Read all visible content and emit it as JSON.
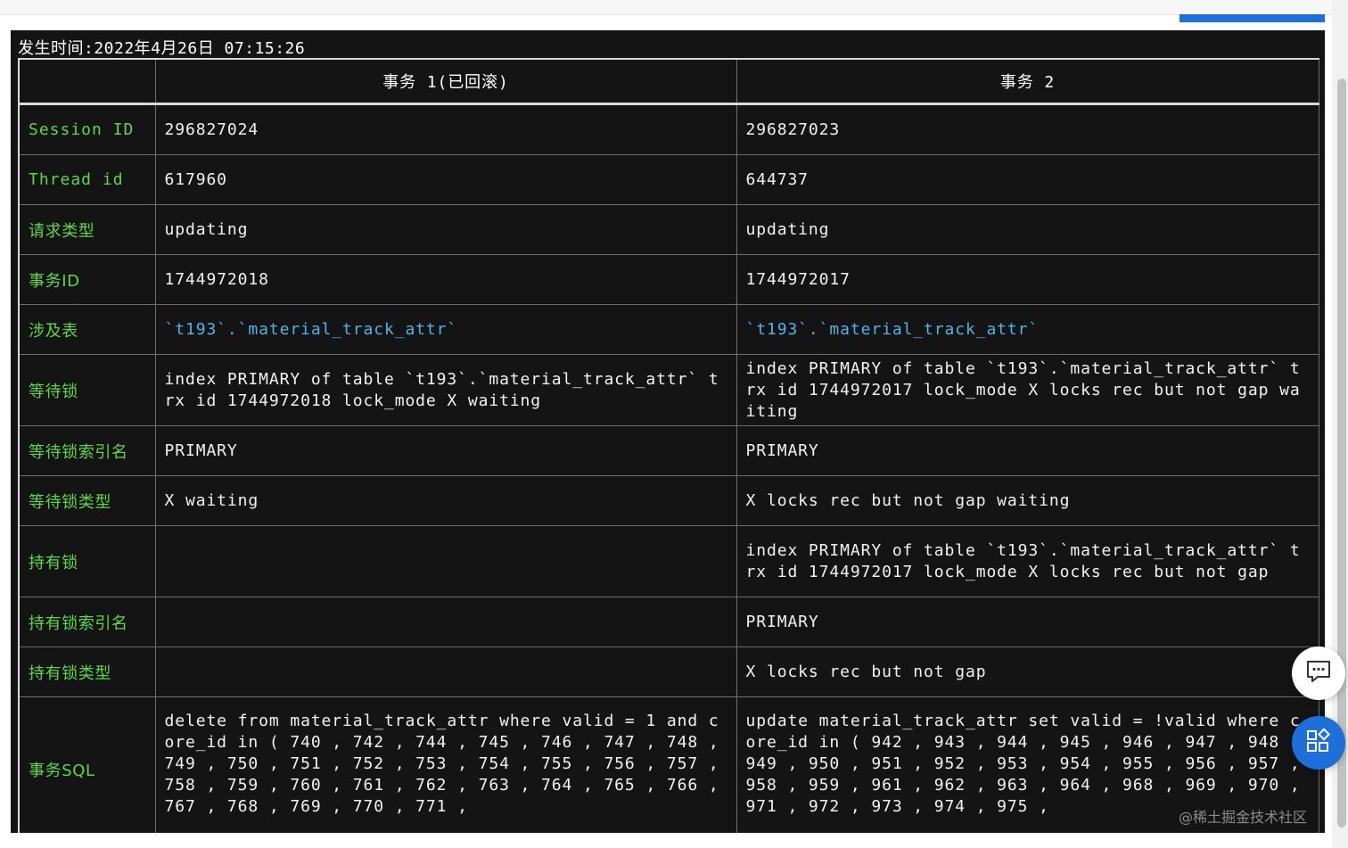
{
  "timestamp_label": "发生时间:2022年4月26日 07:15:26",
  "table": {
    "headers": [
      "",
      "事务 1(已回滚)",
      "事务 2"
    ],
    "rows": [
      {
        "label": "Session ID",
        "t1": "296827024",
        "t2": "296827023"
      },
      {
        "label": "Thread id",
        "t1": "617960",
        "t2": "644737"
      },
      {
        "label": "请求类型",
        "t1": "updating",
        "t2": "updating"
      },
      {
        "label": "事务ID",
        "t1": "1744972018",
        "t2": "1744972017"
      },
      {
        "label": "涉及表",
        "t1": "`t193`.`material_track_attr`",
        "t2": "`t193`.`material_track_attr`"
      },
      {
        "label": "等待锁",
        "t1": "index PRIMARY of table `t193`.`material_track_attr` trx id 1744972018 lock_mode X waiting",
        "t2": "index PRIMARY of table `t193`.`material_track_attr` trx id 1744972017 lock_mode X locks rec but not gap waiting"
      },
      {
        "label": "等待锁索引名",
        "t1": "PRIMARY",
        "t2": "PRIMARY"
      },
      {
        "label": "等待锁类型",
        "t1": "X waiting",
        "t2": "X locks rec but not gap waiting"
      },
      {
        "label": "持有锁",
        "t1": "",
        "t2": "index PRIMARY of table `t193`.`material_track_attr` trx id 1744972017 lock_mode X locks rec but not gap"
      },
      {
        "label": "持有锁索引名",
        "t1": "",
        "t2": "PRIMARY"
      },
      {
        "label": "持有锁类型",
        "t1": "",
        "t2": "X locks rec but not gap"
      },
      {
        "label": "事务SQL",
        "t1": "delete from material_track_attr where valid = 1 and core_id in ( 740 , 742 , 744 , 745 , 746 , 747 , 748 , 749 , 750 , 751 , 752 , 753 , 754 , 755 , 756 , 757 , 758 , 759 , 760 , 761 , 762 , 763 , 764 , 765 , 766 , 767 , 768 , 769 , 770 , 771 ,",
        "t2": "update material_track_attr set valid = !valid where core_id in ( 942 , 943 , 944 , 945 , 946 , 947 , 948 , 949 , 950 , 951 , 952 , 953 , 954 , 955 , 956 , 957 , 958 , 959 , 961 , 962 , 963 , 964 , 968 , 969 , 970 , 971 , 972 , 973 , 974 , 975 ,"
      }
    ]
  },
  "watermark": "@稀土掘金技术社区",
  "icons": {
    "chat": "chat-bubble-icon",
    "apps": "apps-grid-icon"
  },
  "colors": {
    "terminal_bg": "#141414",
    "label_green": "#5fd54a",
    "link_blue": "#4fb3e8",
    "accent_blue": "#1e6fd9"
  }
}
